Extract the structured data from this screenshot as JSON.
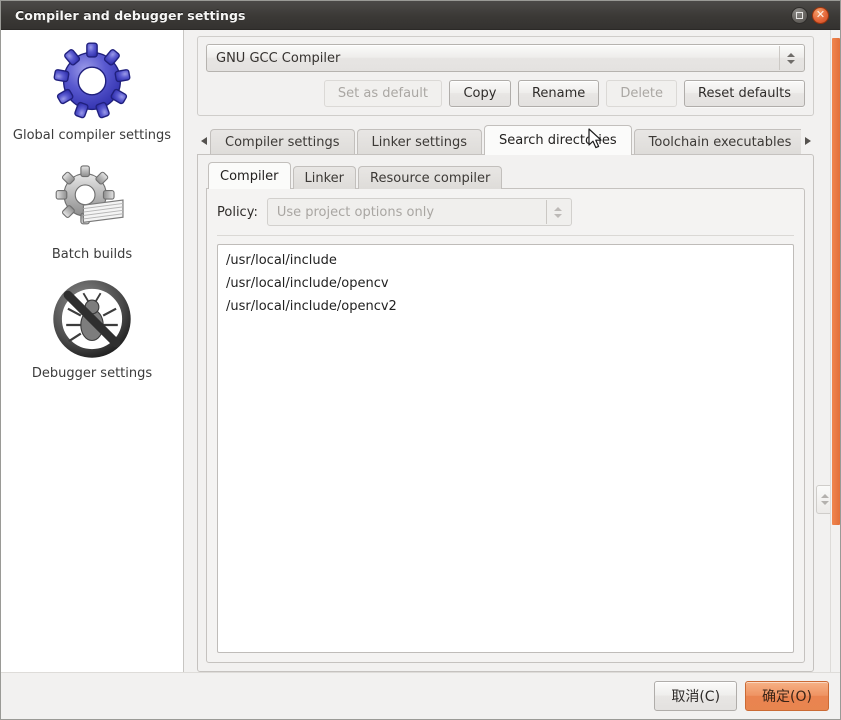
{
  "window": {
    "title": "Compiler and debugger settings",
    "controls": [
      {
        "name": "maximize-button",
        "icon": "maximize-icon"
      },
      {
        "name": "close-button",
        "icon": "close-icon",
        "glyph": "✕"
      }
    ]
  },
  "sidebar": {
    "items": [
      {
        "label": "Global compiler settings",
        "icon": "blue-gear-icon"
      },
      {
        "label": "Batch builds",
        "icon": "gear-stack-icon"
      },
      {
        "label": "Debugger settings",
        "icon": "no-bug-icon"
      }
    ]
  },
  "selector": {
    "compiler_value": "GNU GCC Compiler",
    "buttons": [
      {
        "label": "Set as default",
        "disabled": true
      },
      {
        "label": "Copy",
        "disabled": false
      },
      {
        "label": "Rename",
        "disabled": false
      },
      {
        "label": "Delete",
        "disabled": true
      },
      {
        "label": "Reset defaults",
        "disabled": false
      }
    ]
  },
  "tabs": {
    "scroll_left": "◀",
    "scroll_right": "▶",
    "items": [
      {
        "label": "Compiler settings",
        "active": false
      },
      {
        "label": "Linker settings",
        "active": false
      },
      {
        "label": "Search directories",
        "active": true
      },
      {
        "label": "Toolchain executables",
        "active": false
      }
    ]
  },
  "inner_tabs": {
    "items": [
      {
        "label": "Compiler",
        "active": true
      },
      {
        "label": "Linker",
        "active": false
      },
      {
        "label": "Resource compiler",
        "active": false
      }
    ]
  },
  "policy": {
    "label": "Policy:",
    "value": "Use project options only",
    "disabled": true
  },
  "directories": {
    "entries": [
      "/usr/local/include",
      "/usr/local/include/opencv",
      "/usr/local/include/opencv2"
    ]
  },
  "actions": {
    "cancel_label": "取消(C)",
    "ok_label": "确定(O)"
  },
  "colors": {
    "titlebar": "#3b3936",
    "accent_orange": "#e8854f",
    "close_button": "#e4673a",
    "panel_bg": "#f2f1f0"
  }
}
